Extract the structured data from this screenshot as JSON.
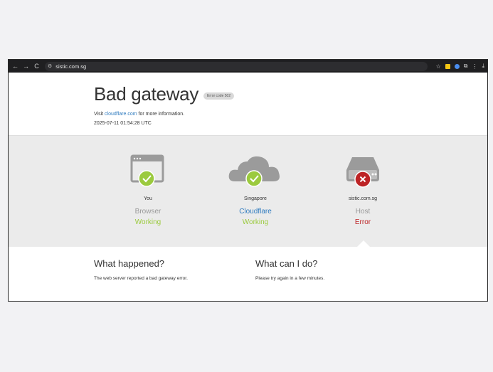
{
  "browser": {
    "url": "sistic.com.sg",
    "nav": {
      "back": "←",
      "forward": "→",
      "reload": "C"
    },
    "toolbar_icons": [
      "star-icon",
      "extension-yellow-icon",
      "extension-blue-icon",
      "puzzle-icon",
      "menu-dots-icon",
      "download-icon"
    ]
  },
  "error": {
    "title": "Bad gateway",
    "badge": "Error code 502",
    "visit_prefix": "Visit ",
    "visit_link": "cloudflare.com",
    "visit_suffix": " for more information.",
    "timestamp": "2025-07-11 01:54:28 UTC"
  },
  "status": [
    {
      "place": "You",
      "kind": "Browser",
      "state": "Working"
    },
    {
      "place": "Singapore",
      "kind": "Cloudflare",
      "state": "Working"
    },
    {
      "place": "sistic.com.sg",
      "kind": "Host",
      "state": "Error"
    }
  ],
  "colors": {
    "ok": "#9bca3e",
    "error": "#bd2426",
    "link": "#2f7bbf",
    "icon_gray": "#9b9b9b"
  },
  "what_happened": {
    "heading": "What happened?",
    "text": "The web server reported a bad gateway error."
  },
  "what_can_i_do": {
    "heading": "What can I do?",
    "text": "Please try again in a few minutes."
  }
}
